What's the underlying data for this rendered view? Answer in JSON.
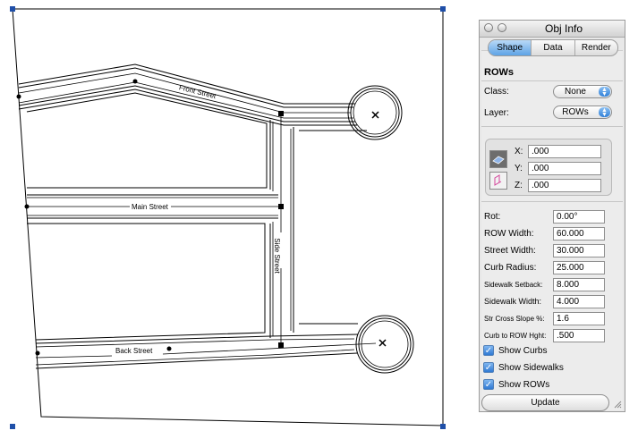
{
  "drawing": {
    "street_labels": {
      "front": "Front Street",
      "main": "Main Street",
      "side": "Side Street",
      "back": "Back Street"
    }
  },
  "obj_info": {
    "title": "Obj Info",
    "tabs": [
      {
        "label": "Shape",
        "active": true
      },
      {
        "label": "Data",
        "active": false
      },
      {
        "label": "Render",
        "active": false
      }
    ],
    "object_name": "ROWs",
    "class_label": "Class:",
    "class_value": "None",
    "layer_label": "Layer:",
    "layer_value": "ROWs",
    "coords": {
      "x_label": "X:",
      "x_value": ".000",
      "y_label": "Y:",
      "y_value": ".000",
      "z_label": "Z:",
      "z_value": ".000"
    },
    "fields": [
      {
        "label": "Rot:",
        "value": "0.00°"
      },
      {
        "label": "ROW Width:",
        "value": "60.000"
      },
      {
        "label": "Street Width:",
        "value": "30.000"
      },
      {
        "label": "Curb Radius:",
        "value": "25.000"
      },
      {
        "label": "Sidewalk Setback:",
        "value": "8.000"
      },
      {
        "label": "Sidewalk Width:",
        "value": "4.000"
      },
      {
        "label": "Str Cross Slope %:",
        "value": "1.6"
      },
      {
        "label": "Curb to ROW Hght:",
        "value": ".500"
      }
    ],
    "checkboxes": [
      {
        "label": "Show Curbs",
        "checked": true
      },
      {
        "label": "Show Sidewalks",
        "checked": true
      },
      {
        "label": "Show ROWs",
        "checked": true
      }
    ],
    "update_label": "Update"
  },
  "colors": {
    "selection_handle": "#1f4fa8",
    "tab_active": "#5ea3e6",
    "checkbox": "#2f79d2"
  }
}
